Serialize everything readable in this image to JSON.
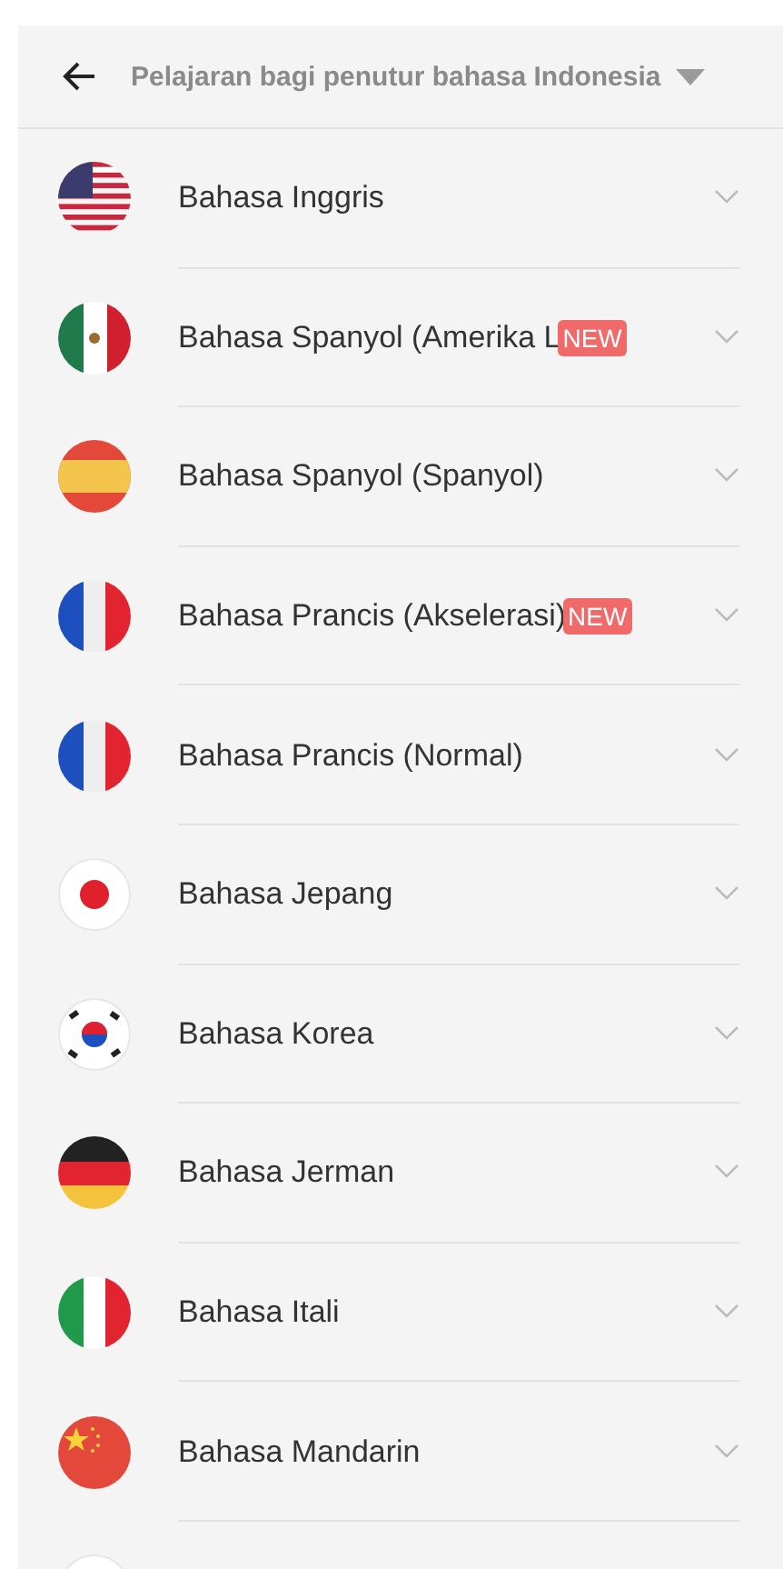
{
  "header": {
    "title": "Pelajaran bagi penutur bahasa Indonesia"
  },
  "courses": [
    {
      "kind": "us",
      "name": "Bahasa Inggris"
    },
    {
      "kind": "mx",
      "name": "Bahasa Spanyol (Amerika L",
      "badge": "NEW"
    },
    {
      "kind": "es",
      "name": "Bahasa Spanyol (Spanyol)"
    },
    {
      "kind": "fr",
      "name": "Bahasa Prancis (Akselerasi)",
      "badge": "NEW"
    },
    {
      "kind": "fr",
      "name": "Bahasa Prancis (Normal)"
    },
    {
      "kind": "jp",
      "name": "Bahasa Jepang"
    },
    {
      "kind": "kr",
      "name": "Bahasa Korea"
    },
    {
      "kind": "de",
      "name": "Bahasa Jerman"
    },
    {
      "kind": "it",
      "name": "Bahasa Itali"
    },
    {
      "kind": "cn",
      "name": "Bahasa Mandarin"
    },
    {
      "kind": "plain"
    }
  ]
}
